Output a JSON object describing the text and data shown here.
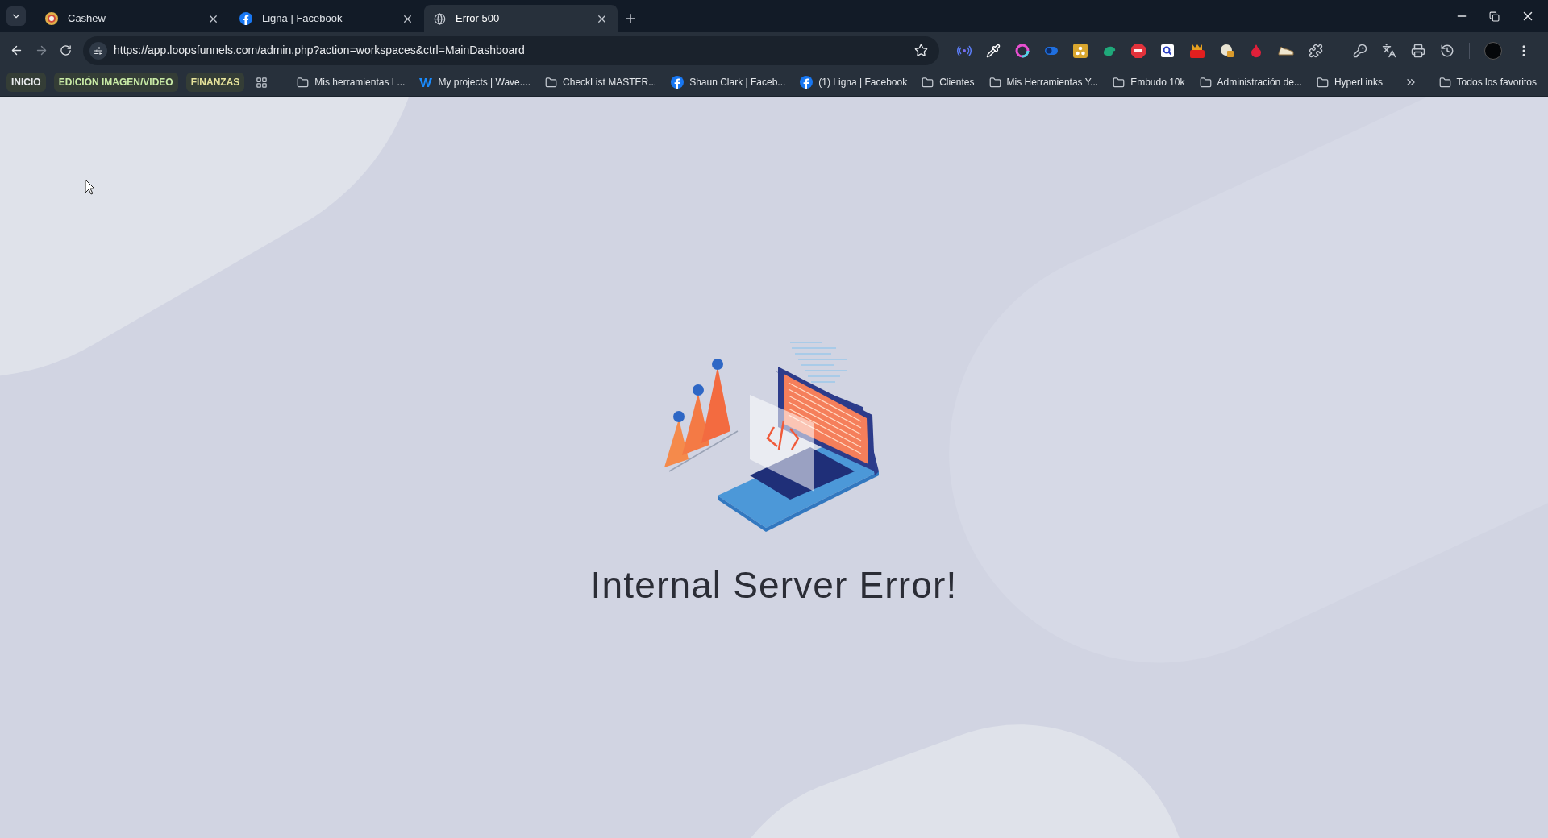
{
  "tabs": [
    {
      "title": "Cashew",
      "kind": "chrome",
      "selected": false
    },
    {
      "title": "Ligna | Facebook",
      "kind": "facebook",
      "selected": false
    },
    {
      "title": "Error 500",
      "kind": "globe",
      "selected": true
    }
  ],
  "address_bar": {
    "url": "https://app.loopsfunnels.com/admin.php?action=workspaces&ctrl=MainDashboard"
  },
  "tab_groups": [
    {
      "label": "INICIO",
      "color": "#e8eaed"
    },
    {
      "label": "EDICIÓN IMAGEN/VIDEO",
      "color": "#c9eba6"
    },
    {
      "label": "FINANZAS",
      "color": "#e6e39b"
    }
  ],
  "bookmarks": [
    {
      "label": "Mis herramientas L...",
      "kind": "folder"
    },
    {
      "label": "My projects | Wave....",
      "kind": "wave"
    },
    {
      "label": "CheckList MASTER...",
      "kind": "folder"
    },
    {
      "label": "Shaun Clark | Faceb...",
      "kind": "facebook"
    },
    {
      "label": "(1) Ligna | Facebook",
      "kind": "facebook"
    },
    {
      "label": "Clientes",
      "kind": "folder"
    },
    {
      "label": "Mis Herramientas Y...",
      "kind": "folder"
    },
    {
      "label": "Embudo 10k",
      "kind": "folder"
    },
    {
      "label": "Administración de...",
      "kind": "folder"
    },
    {
      "label": "HyperLinks",
      "kind": "folder"
    }
  ],
  "other_bookmarks": {
    "label": "Todos los favoritos"
  },
  "page": {
    "heading": "Internal Server Error!"
  }
}
